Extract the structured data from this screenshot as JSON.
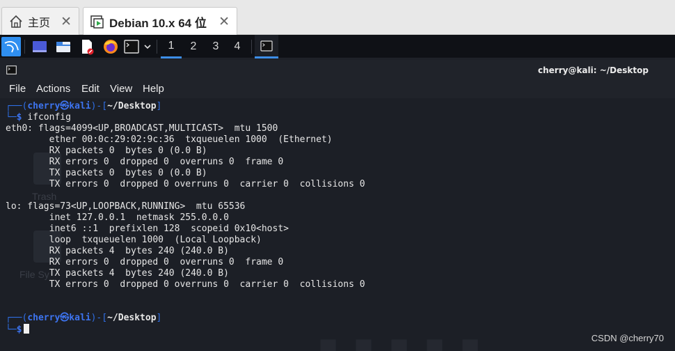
{
  "vm_tabs": {
    "home_label": "主页",
    "vm_label": "Debian 10.x 64 位",
    "close_glyph": "✕"
  },
  "panel": {
    "workspaces": [
      "1",
      "2",
      "3",
      "4"
    ],
    "accent": "#3d8ee8"
  },
  "terminal": {
    "title": "cherry@kali: ~/Desktop",
    "menus": [
      "File",
      "Actions",
      "Edit",
      "View",
      "Help"
    ],
    "prompt": {
      "box_top": "┌──(",
      "user": "cherry",
      "at": "㉿",
      "host": "kali",
      "close": ")-[",
      "path": "~/Desktop",
      "end": "]",
      "box_bottom": "└─",
      "dollar": "$"
    },
    "command": "ifconfig",
    "output": [
      "eth0: flags=4099<UP,BROADCAST,MULTICAST>  mtu 1500",
      "        ether 00:0c:29:02:9c:36  txqueuelen 1000  (Ethernet)",
      "        RX packets 0  bytes 0 (0.0 B)",
      "        RX errors 0  dropped 0  overruns 0  frame 0",
      "        TX packets 0  bytes 0 (0.0 B)",
      "        TX errors 0  dropped 0 overruns 0  carrier 0  collisions 0",
      "",
      "lo: flags=73<UP,LOOPBACK,RUNNING>  mtu 65536",
      "        inet 127.0.0.1  netmask 255.0.0.0",
      "        inet6 ::1  prefixlen 128  scopeid 0x10<host>",
      "        loop  txqueuelen 1000  (Local Loopback)",
      "        RX packets 4  bytes 240 (240.0 B)",
      "        RX errors 0  dropped 0  overruns 0  frame 0",
      "        TX packets 4  bytes 240 (240.0 B)",
      "        TX errors 0  dropped 0 overruns 0  carrier 0  collisions 0"
    ]
  },
  "desktop_labels": [
    "Trash",
    "File Sy"
  ],
  "watermark": "CSDN @cherry70"
}
